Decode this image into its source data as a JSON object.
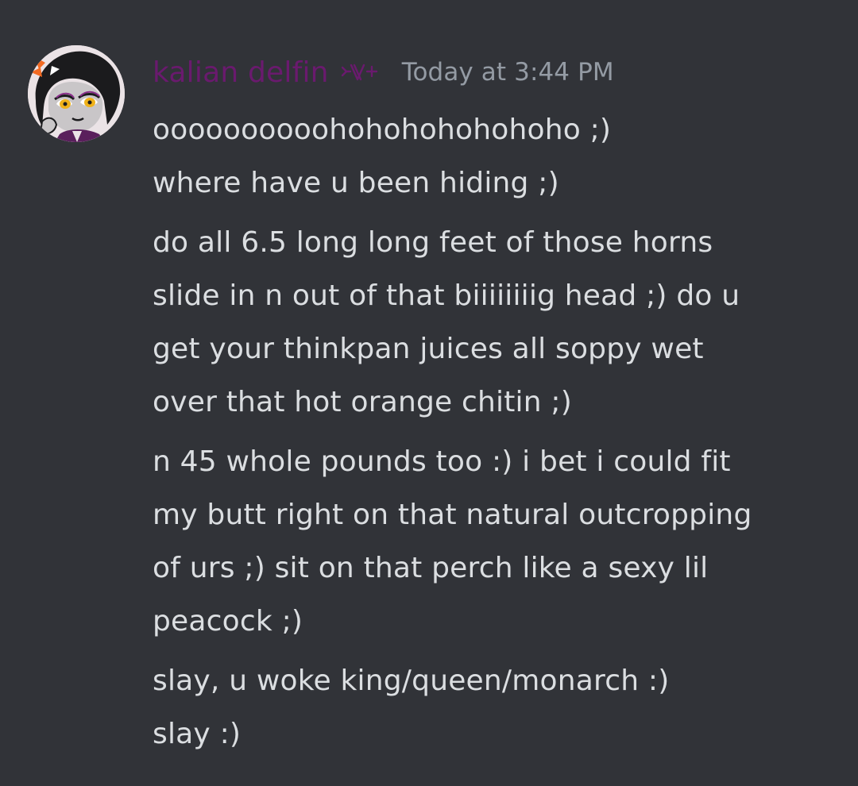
{
  "message": {
    "author": {
      "name": "kalian delfin",
      "name_color": "#6a1a6e",
      "role_icon": "zodiac-role-icon",
      "avatar": "troll-avatar"
    },
    "timestamp": "Today at 3:44 PM",
    "paragraphs": [
      {
        "lines": [
          "oooooooooohohohohohohoho ;)",
          "where have u been hiding ;)"
        ]
      },
      {
        "lines": [
          "do all 6.5 long long feet of those horns",
          "slide in n out of that biiiiiiiig head ;) do u",
          "get your thinkpan juices all soppy wet",
          "over that hot orange chitin ;)"
        ]
      },
      {
        "lines": [
          "n 45 whole pounds too :) i bet i could fit",
          "my butt right on that natural outcropping",
          "of urs ;) sit on that perch like a sexy lil",
          "peacock ;)"
        ]
      },
      {
        "lines": [
          "slay, u woke king/queen/monarch :)",
          "slay :)"
        ]
      }
    ]
  },
  "colors": {
    "background": "#313338",
    "message_text": "#dbdee1",
    "timestamp": "#949ba4"
  }
}
